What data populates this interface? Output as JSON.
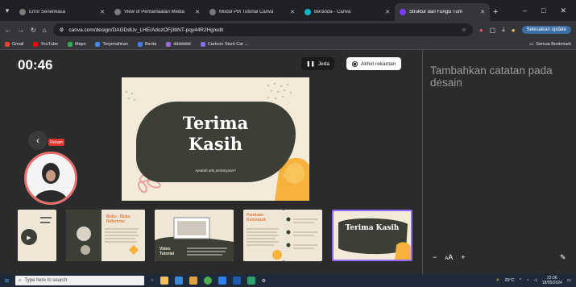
{
  "browser": {
    "tabs": [
      {
        "title": "Error Senenkasa",
        "color": "#7a7a7a",
        "active": false
      },
      {
        "title": "View of Pemanfaatan Media",
        "color": "#7a7a7a",
        "active": false
      },
      {
        "title": "Modul PM Tutorial Canva",
        "color": "#7a7a7a",
        "active": false
      },
      {
        "title": "Beranda - Canva",
        "color": "#0fb6c9",
        "active": false
      },
      {
        "title": "Struktur dan Fungsi Tum",
        "color": "#7d3cff",
        "active": true
      }
    ],
    "new_tab": "+",
    "url": "canva.com/design/DAGDdUv_LHE/AdozOFj3tiNT-pqy44R2Hg/edit",
    "update_label": "Selesaikan update",
    "bookmarks": [
      {
        "label": "Gmail",
        "color": "#ea4335"
      },
      {
        "label": "YouTube",
        "color": "#ff0000"
      },
      {
        "label": "Maps",
        "color": "#34a853"
      },
      {
        "label": "Terjemahkan",
        "color": "#4285f4"
      },
      {
        "label": "Berita",
        "color": "#3f7ee8"
      },
      {
        "label": "ddddddd",
        "color": "#9c6ade"
      },
      {
        "label": "Cartoon Stunt Car ...",
        "color": "#8a6df0"
      }
    ],
    "all_bookmarks": "Semua Bookmark"
  },
  "recording": {
    "timer": "00:46",
    "pause_label": "Jeda",
    "stop_label": "Akhiri rekaman",
    "rec_badge": "Rekam"
  },
  "slide": {
    "title_line1": "Terima",
    "title_line2": "Kasih",
    "subtitle": "Apakah ada pertanyaan?"
  },
  "thumbnails": [
    {
      "title": "",
      "selected": false
    },
    {
      "title": "Buku - Buku Referensi",
      "selected": false
    },
    {
      "title": "Video Tutorial",
      "selected": false
    },
    {
      "title": "Panduan Kelompok",
      "selected": false
    },
    {
      "title": "",
      "selected": false
    },
    {
      "title": "Terima Kasih",
      "selected": true
    }
  ],
  "notes": {
    "placeholder": "Tambahkan catatan pada desain",
    "zoom_out": "−",
    "zoom_label": "A",
    "zoom_in": "+"
  },
  "taskbar": {
    "search_placeholder": "Type here to search",
    "weather": "29°C",
    "time": "22:06",
    "date": "18/05/2024"
  },
  "colors": {
    "accent": "#8d6bff",
    "slide_bg": "#f3ead9",
    "slide_blob": "#3b3f35",
    "flower_orange": "#f6b23b",
    "flower_pink": "#e8a0a0",
    "rec_red": "#e0352f"
  }
}
